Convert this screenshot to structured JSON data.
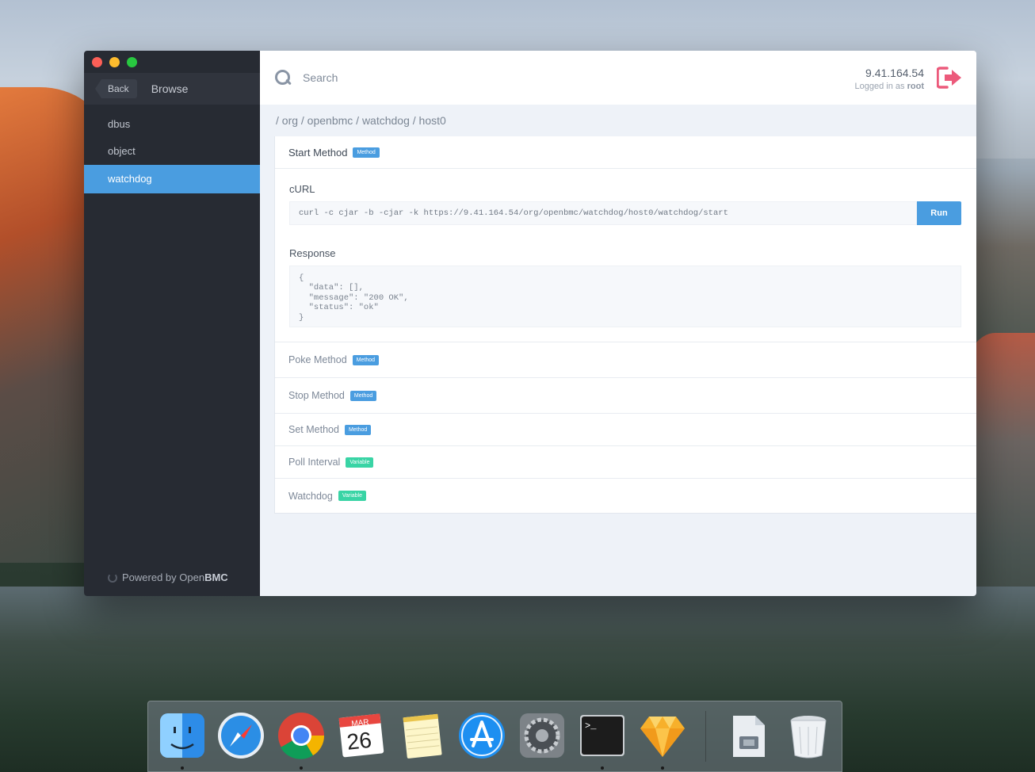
{
  "sidebar": {
    "back_label": "Back",
    "title": "Browse",
    "items": [
      {
        "label": "dbus"
      },
      {
        "label": "object"
      },
      {
        "label": "watchdog"
      }
    ],
    "footer_prefix": "Powered by Open",
    "footer_brand": "BMC"
  },
  "header": {
    "search_placeholder": "Search",
    "host_ip": "9.41.164.54",
    "logged_in_prefix": "Logged in as",
    "user": "root"
  },
  "breadcrumb": "/ org / openbmc / watchdog / host0",
  "sections": [
    {
      "title": "Start Method",
      "badge": "Method"
    },
    {
      "title": "Poke Method",
      "badge": "Method"
    },
    {
      "title": "Stop Method",
      "badge": "Method"
    },
    {
      "title": "Set Method",
      "badge": "Method"
    },
    {
      "title": "Poll Interval",
      "badge": "Variable"
    },
    {
      "title": "Watchdog",
      "badge": "Variable"
    }
  ],
  "expanded": {
    "curl_label": "cURL",
    "curl_command": "curl -c cjar -b -cjar -k https://9.41.164.54/org/openbmc/watchdog/host0/watchdog/start",
    "run_label": "Run",
    "response_label": "Response",
    "response_body": "{\n  \"data\": [],\n  \"message\": \"200 OK\",\n  \"status\": \"ok\"\n}"
  },
  "dock": {
    "apps": [
      "finder-icon",
      "safari-icon",
      "chrome-icon",
      "calendar-icon",
      "notes-icon",
      "app-store-icon",
      "system-preferences-icon",
      "terminal-icon",
      "sketch-icon",
      "downloads-folder-icon",
      "trash-icon"
    ],
    "calendar_month": "MAR",
    "calendar_day": "26",
    "terminal_prompt": ">_"
  },
  "colors": {
    "accent": "#4a9de0",
    "variable_badge": "#39d4a5",
    "logout": "#ec5a7b",
    "sidebar_bg": "#272b33"
  }
}
